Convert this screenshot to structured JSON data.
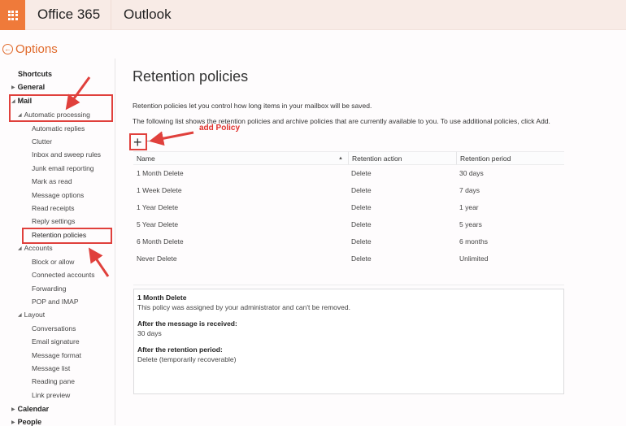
{
  "topbar": {
    "brand": "Office 365",
    "app_name": "Outlook",
    "accent_color": "#ef7a3a"
  },
  "back_link": {
    "label": "Options"
  },
  "sidebar": {
    "shortcuts": "Shortcuts",
    "general": "General",
    "mail": "Mail",
    "automatic_processing": "Automatic processing",
    "auto_items": [
      "Automatic replies",
      "Clutter",
      "Inbox and sweep rules",
      "Junk email reporting",
      "Mark as read",
      "Message options",
      "Read receipts",
      "Reply settings",
      "Retention policies"
    ],
    "accounts": "Accounts",
    "account_items": [
      "Block or allow",
      "Connected accounts",
      "Forwarding",
      "POP and IMAP"
    ],
    "layout": "Layout",
    "layout_items": [
      "Conversations",
      "Email signature",
      "Message format",
      "Message list",
      "Reading pane",
      "Link preview"
    ],
    "calendar": "Calendar",
    "people": "People"
  },
  "main": {
    "title": "Retention policies",
    "desc1": "Retention policies let you control how long items in your mailbox will be saved.",
    "desc2": "The following list shows the retention policies and archive policies that are currently available to you. To use additional policies, click Add.",
    "add_symbol": "+",
    "remove_symbol": "—",
    "columns": [
      "Name",
      "Retention action",
      "Retention period"
    ],
    "rows": [
      {
        "name": "1 Month Delete",
        "action": "Delete",
        "period": "30 days"
      },
      {
        "name": "1 Week Delete",
        "action": "Delete",
        "period": "7 days"
      },
      {
        "name": "1 Year Delete",
        "action": "Delete",
        "period": "1 year"
      },
      {
        "name": "5 Year Delete",
        "action": "Delete",
        "period": "5 years"
      },
      {
        "name": "6 Month Delete",
        "action": "Delete",
        "period": "6 months"
      },
      {
        "name": "Never Delete",
        "action": "Delete",
        "period": "Unlimited"
      }
    ],
    "details": {
      "title": "1 Month Delete",
      "note": "This policy was assigned by your administrator and can't be removed.",
      "received_label": "After the message is received:",
      "received_value": "30 days",
      "after_label": "After the retention period:",
      "after_value": "Delete (temporarily recoverable)"
    }
  },
  "annotations": {
    "add_policy": "add Policy",
    "color": "#e0403c"
  }
}
